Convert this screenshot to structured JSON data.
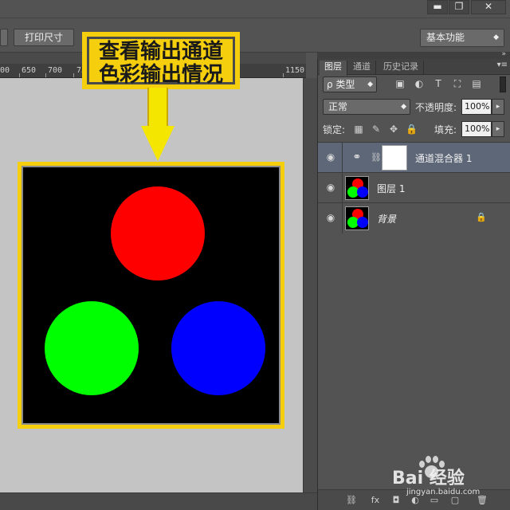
{
  "window": {
    "min_label": "▬",
    "max_label": "❐",
    "close_label": "✕"
  },
  "options_bar": {
    "print_size_label": "打印尺寸",
    "workspace_label": "基本功能"
  },
  "ruler": {
    "ticks": [
      "00",
      "650",
      "700",
      "750",
      "1150"
    ]
  },
  "callout": {
    "line1": "查看输出通道",
    "line2": "色彩输出情况"
  },
  "document": {
    "circles": [
      {
        "name": "red-circle",
        "color": "#ff0000"
      },
      {
        "name": "green-circle",
        "color": "#00ff00"
      },
      {
        "name": "blue-circle",
        "color": "#0000ff"
      }
    ]
  },
  "layers_panel": {
    "tabs": [
      "图层",
      "通道",
      "历史记录"
    ],
    "filter_label": "ρ 类型",
    "blend_mode": "正常",
    "opacity_label": "不透明度:",
    "opacity_value": "100%",
    "lock_label": "锁定:",
    "fill_label": "填充:",
    "fill_value": "100%",
    "layers": [
      {
        "name": "通道混合器 1",
        "type": "adjustment",
        "selected": true
      },
      {
        "name": "图层 1",
        "type": "pixel",
        "selected": false
      },
      {
        "name": "背景",
        "type": "background",
        "locked": true,
        "selected": false
      }
    ]
  },
  "watermark": {
    "brand": "Bai 经验",
    "url": "jingyan.baidu.com"
  }
}
